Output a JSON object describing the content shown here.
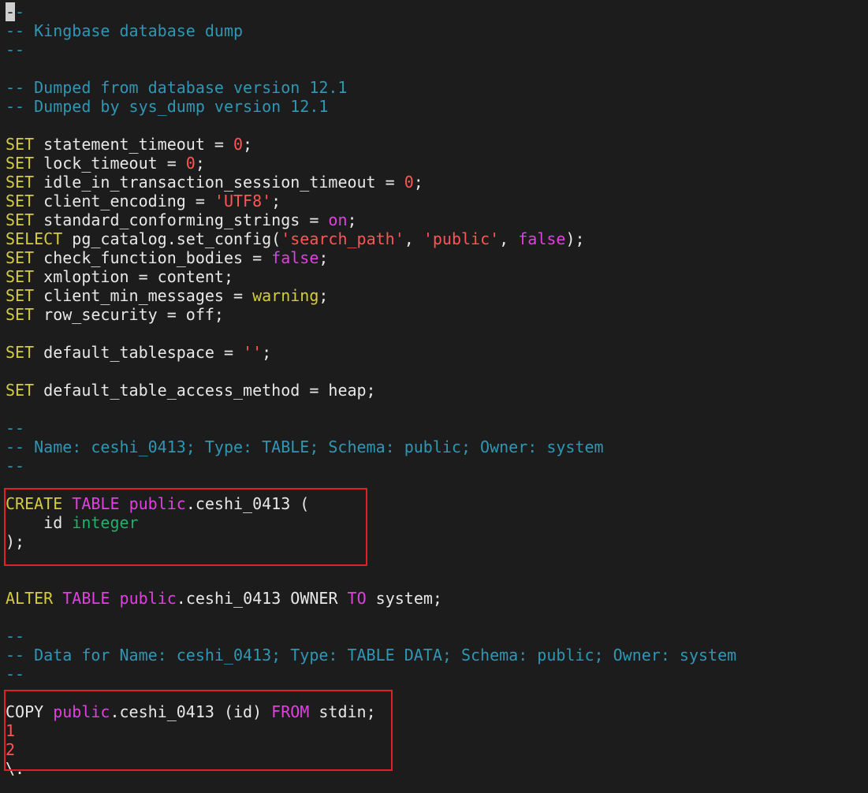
{
  "lines": [
    {
      "segs": [
        {
          "t": "-",
          "c": "cursor"
        },
        {
          "t": "-",
          "c": "cmt"
        }
      ]
    },
    {
      "segs": [
        {
          "t": "-- Kingbase database dump",
          "c": "cmt"
        }
      ]
    },
    {
      "segs": [
        {
          "t": "--",
          "c": "cmt"
        }
      ]
    },
    {
      "segs": []
    },
    {
      "segs": [
        {
          "t": "-- Dumped from database version 12.1",
          "c": "cmt"
        }
      ]
    },
    {
      "segs": [
        {
          "t": "-- Dumped by sys_dump version 12.1",
          "c": "cmt"
        }
      ]
    },
    {
      "segs": []
    },
    {
      "segs": [
        {
          "t": "SET",
          "c": "kw"
        },
        {
          "t": " statement_timeout = ",
          "c": ""
        },
        {
          "t": "0",
          "c": "num"
        },
        {
          "t": ";",
          "c": ""
        }
      ]
    },
    {
      "segs": [
        {
          "t": "SET",
          "c": "kw"
        },
        {
          "t": " lock_timeout = ",
          "c": ""
        },
        {
          "t": "0",
          "c": "num"
        },
        {
          "t": ";",
          "c": ""
        }
      ]
    },
    {
      "segs": [
        {
          "t": "SET",
          "c": "kw"
        },
        {
          "t": " idle_in_transaction_session_timeout = ",
          "c": ""
        },
        {
          "t": "0",
          "c": "num"
        },
        {
          "t": ";",
          "c": ""
        }
      ]
    },
    {
      "segs": [
        {
          "t": "SET",
          "c": "kw"
        },
        {
          "t": " client_encoding = ",
          "c": ""
        },
        {
          "t": "'UTF8'",
          "c": "str"
        },
        {
          "t": ";",
          "c": ""
        }
      ]
    },
    {
      "segs": [
        {
          "t": "SET",
          "c": "kw"
        },
        {
          "t": " standard_conforming_strings = ",
          "c": ""
        },
        {
          "t": "on",
          "c": "kw2"
        },
        {
          "t": ";",
          "c": ""
        }
      ]
    },
    {
      "segs": [
        {
          "t": "SELECT",
          "c": "kw"
        },
        {
          "t": " pg_catalog.set_config(",
          "c": ""
        },
        {
          "t": "'search_path'",
          "c": "str"
        },
        {
          "t": ", ",
          "c": ""
        },
        {
          "t": "'public'",
          "c": "str"
        },
        {
          "t": ", ",
          "c": ""
        },
        {
          "t": "false",
          "c": "kw2"
        },
        {
          "t": ");",
          "c": ""
        }
      ]
    },
    {
      "segs": [
        {
          "t": "SET",
          "c": "kw"
        },
        {
          "t": " check_function_bodies = ",
          "c": ""
        },
        {
          "t": "false",
          "c": "kw2"
        },
        {
          "t": ";",
          "c": ""
        }
      ]
    },
    {
      "segs": [
        {
          "t": "SET",
          "c": "kw"
        },
        {
          "t": " xmloption = content;",
          "c": ""
        }
      ]
    },
    {
      "segs": [
        {
          "t": "SET",
          "c": "kw"
        },
        {
          "t": " client_min_messages = ",
          "c": ""
        },
        {
          "t": "warning",
          "c": "kw"
        },
        {
          "t": ";",
          "c": ""
        }
      ]
    },
    {
      "segs": [
        {
          "t": "SET",
          "c": "kw"
        },
        {
          "t": " row_security = off;",
          "c": ""
        }
      ]
    },
    {
      "segs": []
    },
    {
      "segs": [
        {
          "t": "SET",
          "c": "kw"
        },
        {
          "t": " default_tablespace = ",
          "c": ""
        },
        {
          "t": "''",
          "c": "str"
        },
        {
          "t": ";",
          "c": ""
        }
      ]
    },
    {
      "segs": []
    },
    {
      "segs": [
        {
          "t": "SET",
          "c": "kw"
        },
        {
          "t": " default_table_access_method = heap;",
          "c": ""
        }
      ]
    },
    {
      "segs": []
    },
    {
      "segs": [
        {
          "t": "--",
          "c": "cmt"
        }
      ]
    },
    {
      "segs": [
        {
          "t": "-- Name: ceshi_0413; Type: TABLE; Schema: public; Owner: system",
          "c": "cmt"
        }
      ]
    },
    {
      "segs": [
        {
          "t": "--",
          "c": "cmt"
        }
      ]
    },
    {
      "segs": []
    },
    {
      "segs": [
        {
          "t": "CREATE",
          "c": "kw"
        },
        {
          "t": " ",
          "c": ""
        },
        {
          "t": "TABLE",
          "c": "kw2"
        },
        {
          "t": " ",
          "c": ""
        },
        {
          "t": "public",
          "c": "kw2"
        },
        {
          "t": ".ceshi_0413 (",
          "c": ""
        }
      ]
    },
    {
      "segs": [
        {
          "t": "    id ",
          "c": ""
        },
        {
          "t": "integer",
          "c": "type"
        }
      ]
    },
    {
      "segs": [
        {
          "t": ");",
          "c": ""
        }
      ]
    },
    {
      "segs": []
    },
    {
      "segs": []
    },
    {
      "segs": [
        {
          "t": "ALTER",
          "c": "kw"
        },
        {
          "t": " ",
          "c": ""
        },
        {
          "t": "TABLE",
          "c": "kw2"
        },
        {
          "t": " ",
          "c": ""
        },
        {
          "t": "public",
          "c": "kw2"
        },
        {
          "t": ".ceshi_0413 OWNER ",
          "c": ""
        },
        {
          "t": "TO",
          "c": "kw2"
        },
        {
          "t": " system;",
          "c": ""
        }
      ]
    },
    {
      "segs": []
    },
    {
      "segs": [
        {
          "t": "--",
          "c": "cmt"
        }
      ]
    },
    {
      "segs": [
        {
          "t": "-- Data for Name: ceshi_0413; Type: TABLE DATA; Schema: public; Owner: system",
          "c": "cmt"
        }
      ]
    },
    {
      "segs": [
        {
          "t": "--",
          "c": "cmt"
        }
      ]
    },
    {
      "segs": []
    },
    {
      "segs": [
        {
          "t": "COPY ",
          "c": ""
        },
        {
          "t": "public",
          "c": "kw2"
        },
        {
          "t": ".ceshi_0413 (id) ",
          "c": ""
        },
        {
          "t": "FROM",
          "c": "kw2"
        },
        {
          "t": " stdin;",
          "c": ""
        }
      ]
    },
    {
      "segs": [
        {
          "t": "1",
          "c": "num"
        }
      ]
    },
    {
      "segs": [
        {
          "t": "2",
          "c": "num"
        }
      ]
    },
    {
      "segs": [
        {
          "t": "\\.",
          "c": ""
        }
      ]
    }
  ],
  "colors": {
    "background": "#1c1c1c",
    "text": "#e8e8e8",
    "comment": "#2f96b4",
    "keyword": "#d4cc3a",
    "keyword_alt": "#e040e0",
    "number": "#ff5555",
    "type": "#22b06c",
    "highlight_box": "#e0202a"
  }
}
